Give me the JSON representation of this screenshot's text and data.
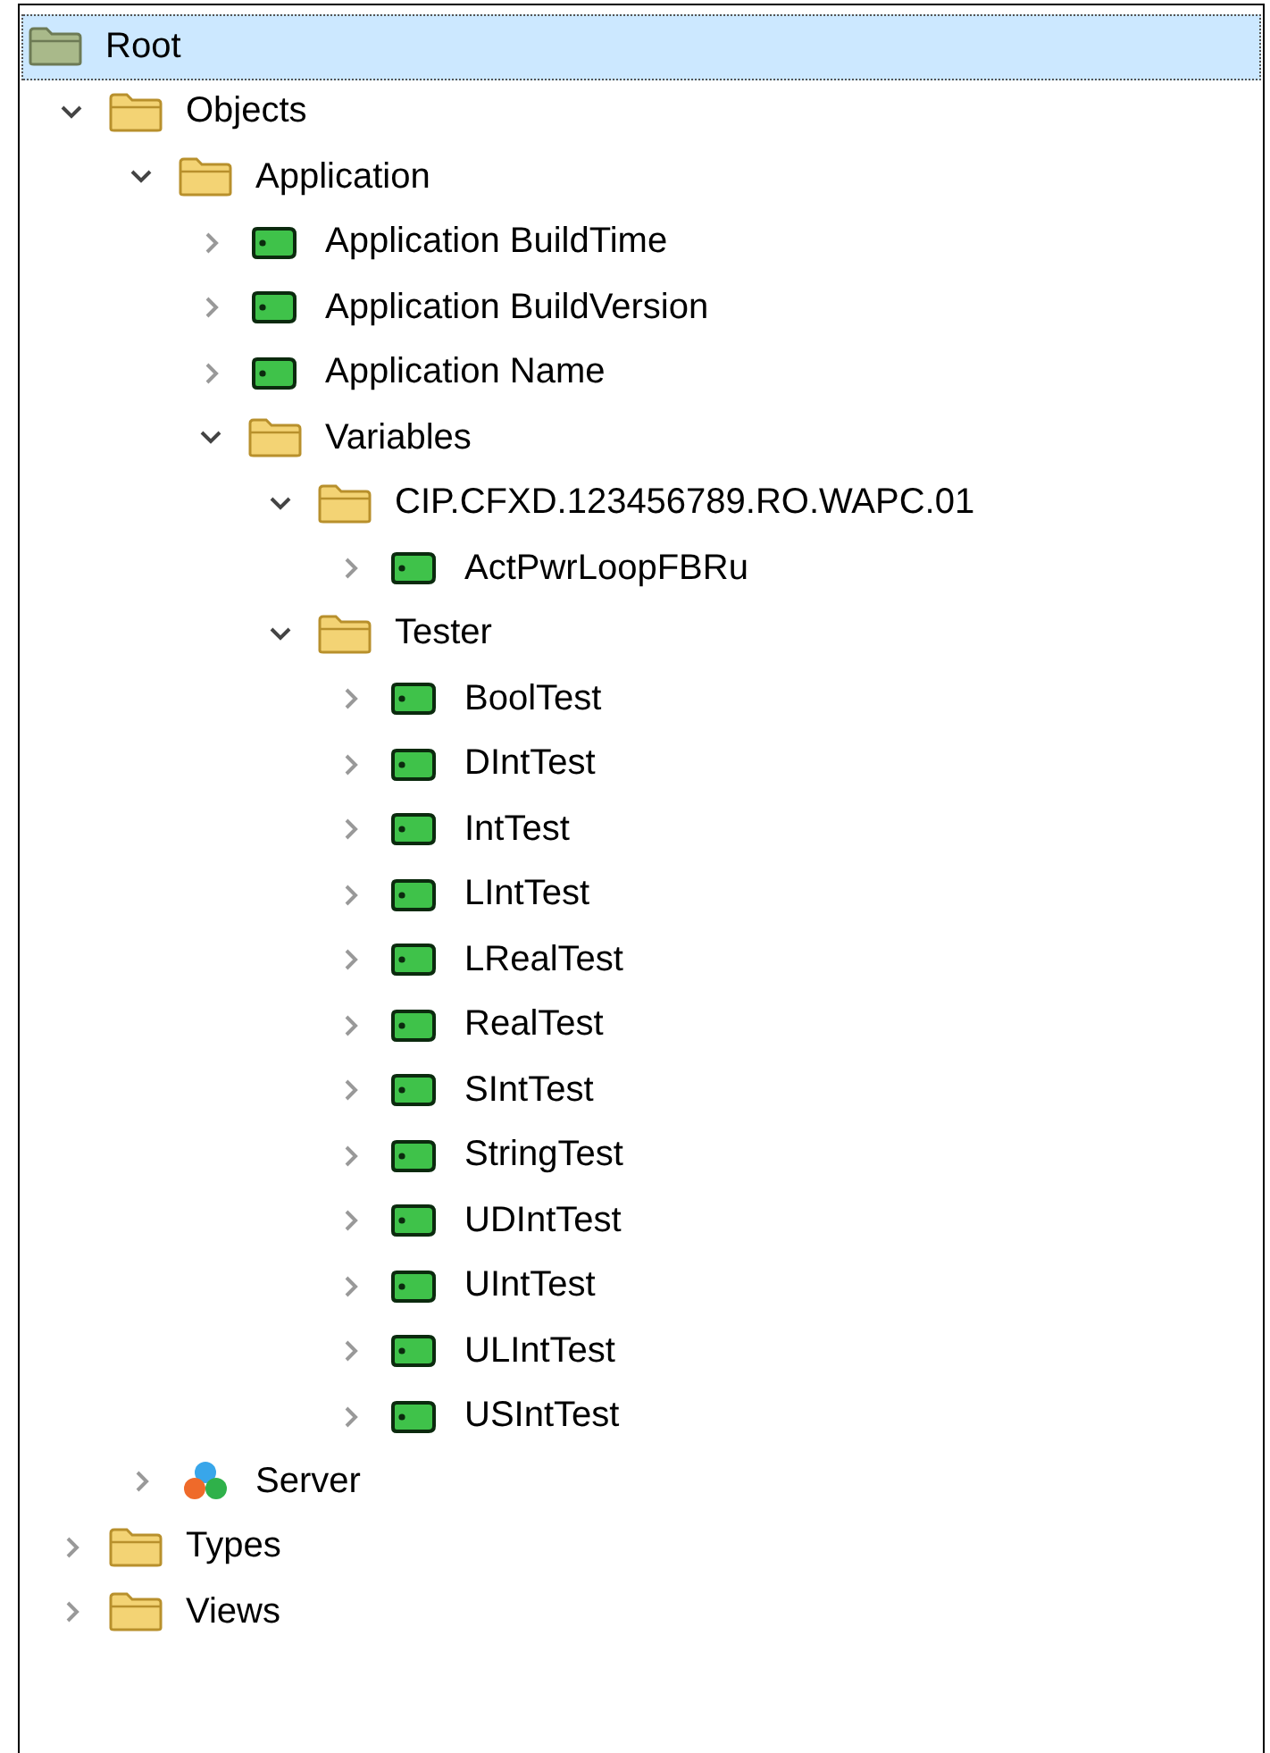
{
  "tree": [
    {
      "label": "Root",
      "kind": "root",
      "selected": true,
      "children": [
        {
          "label": "Objects",
          "kind": "folder",
          "selected": false,
          "expanded": true,
          "children": [
            {
              "label": "Application",
              "kind": "folder",
              "selected": false,
              "expanded": true,
              "children": [
                {
                  "label": "Application BuildTime",
                  "kind": "tag",
                  "selected": false,
                  "expanded": false
                },
                {
                  "label": "Application BuildVersion",
                  "kind": "tag",
                  "selected": false,
                  "expanded": false
                },
                {
                  "label": "Application Name",
                  "kind": "tag",
                  "selected": false,
                  "expanded": false
                },
                {
                  "label": "Variables",
                  "kind": "folder",
                  "selected": false,
                  "expanded": true,
                  "children": [
                    {
                      "label": "CIP.CFXD.123456789.RO.WAPC.01",
                      "kind": "folder",
                      "selected": false,
                      "expanded": true,
                      "children": [
                        {
                          "label": "ActPwrLoopFBRu",
                          "kind": "tag",
                          "selected": false,
                          "expanded": false
                        }
                      ]
                    },
                    {
                      "label": "Tester",
                      "kind": "folder",
                      "selected": false,
                      "expanded": true,
                      "children": [
                        {
                          "label": "BoolTest",
                          "kind": "tag",
                          "selected": false,
                          "expanded": false
                        },
                        {
                          "label": "DIntTest",
                          "kind": "tag",
                          "selected": false,
                          "expanded": false
                        },
                        {
                          "label": "IntTest",
                          "kind": "tag",
                          "selected": false,
                          "expanded": false
                        },
                        {
                          "label": "LIntTest",
                          "kind": "tag",
                          "selected": false,
                          "expanded": false
                        },
                        {
                          "label": "LRealTest",
                          "kind": "tag",
                          "selected": false,
                          "expanded": false
                        },
                        {
                          "label": "RealTest",
                          "kind": "tag",
                          "selected": false,
                          "expanded": false
                        },
                        {
                          "label": "SIntTest",
                          "kind": "tag",
                          "selected": false,
                          "expanded": false
                        },
                        {
                          "label": "StringTest",
                          "kind": "tag",
                          "selected": false,
                          "expanded": false
                        },
                        {
                          "label": "UDIntTest",
                          "kind": "tag",
                          "selected": false,
                          "expanded": false
                        },
                        {
                          "label": "UIntTest",
                          "kind": "tag",
                          "selected": false,
                          "expanded": false
                        },
                        {
                          "label": "ULIntTest",
                          "kind": "tag",
                          "selected": false,
                          "expanded": false
                        },
                        {
                          "label": "USIntTest",
                          "kind": "tag",
                          "selected": false,
                          "expanded": false
                        }
                      ]
                    }
                  ]
                }
              ]
            },
            {
              "label": "Server",
              "kind": "server",
              "selected": false,
              "expanded": false
            }
          ]
        },
        {
          "label": "Types",
          "kind": "folder",
          "selected": false,
          "expanded": false
        },
        {
          "label": "Views",
          "kind": "folder",
          "selected": false,
          "expanded": false
        }
      ]
    }
  ]
}
